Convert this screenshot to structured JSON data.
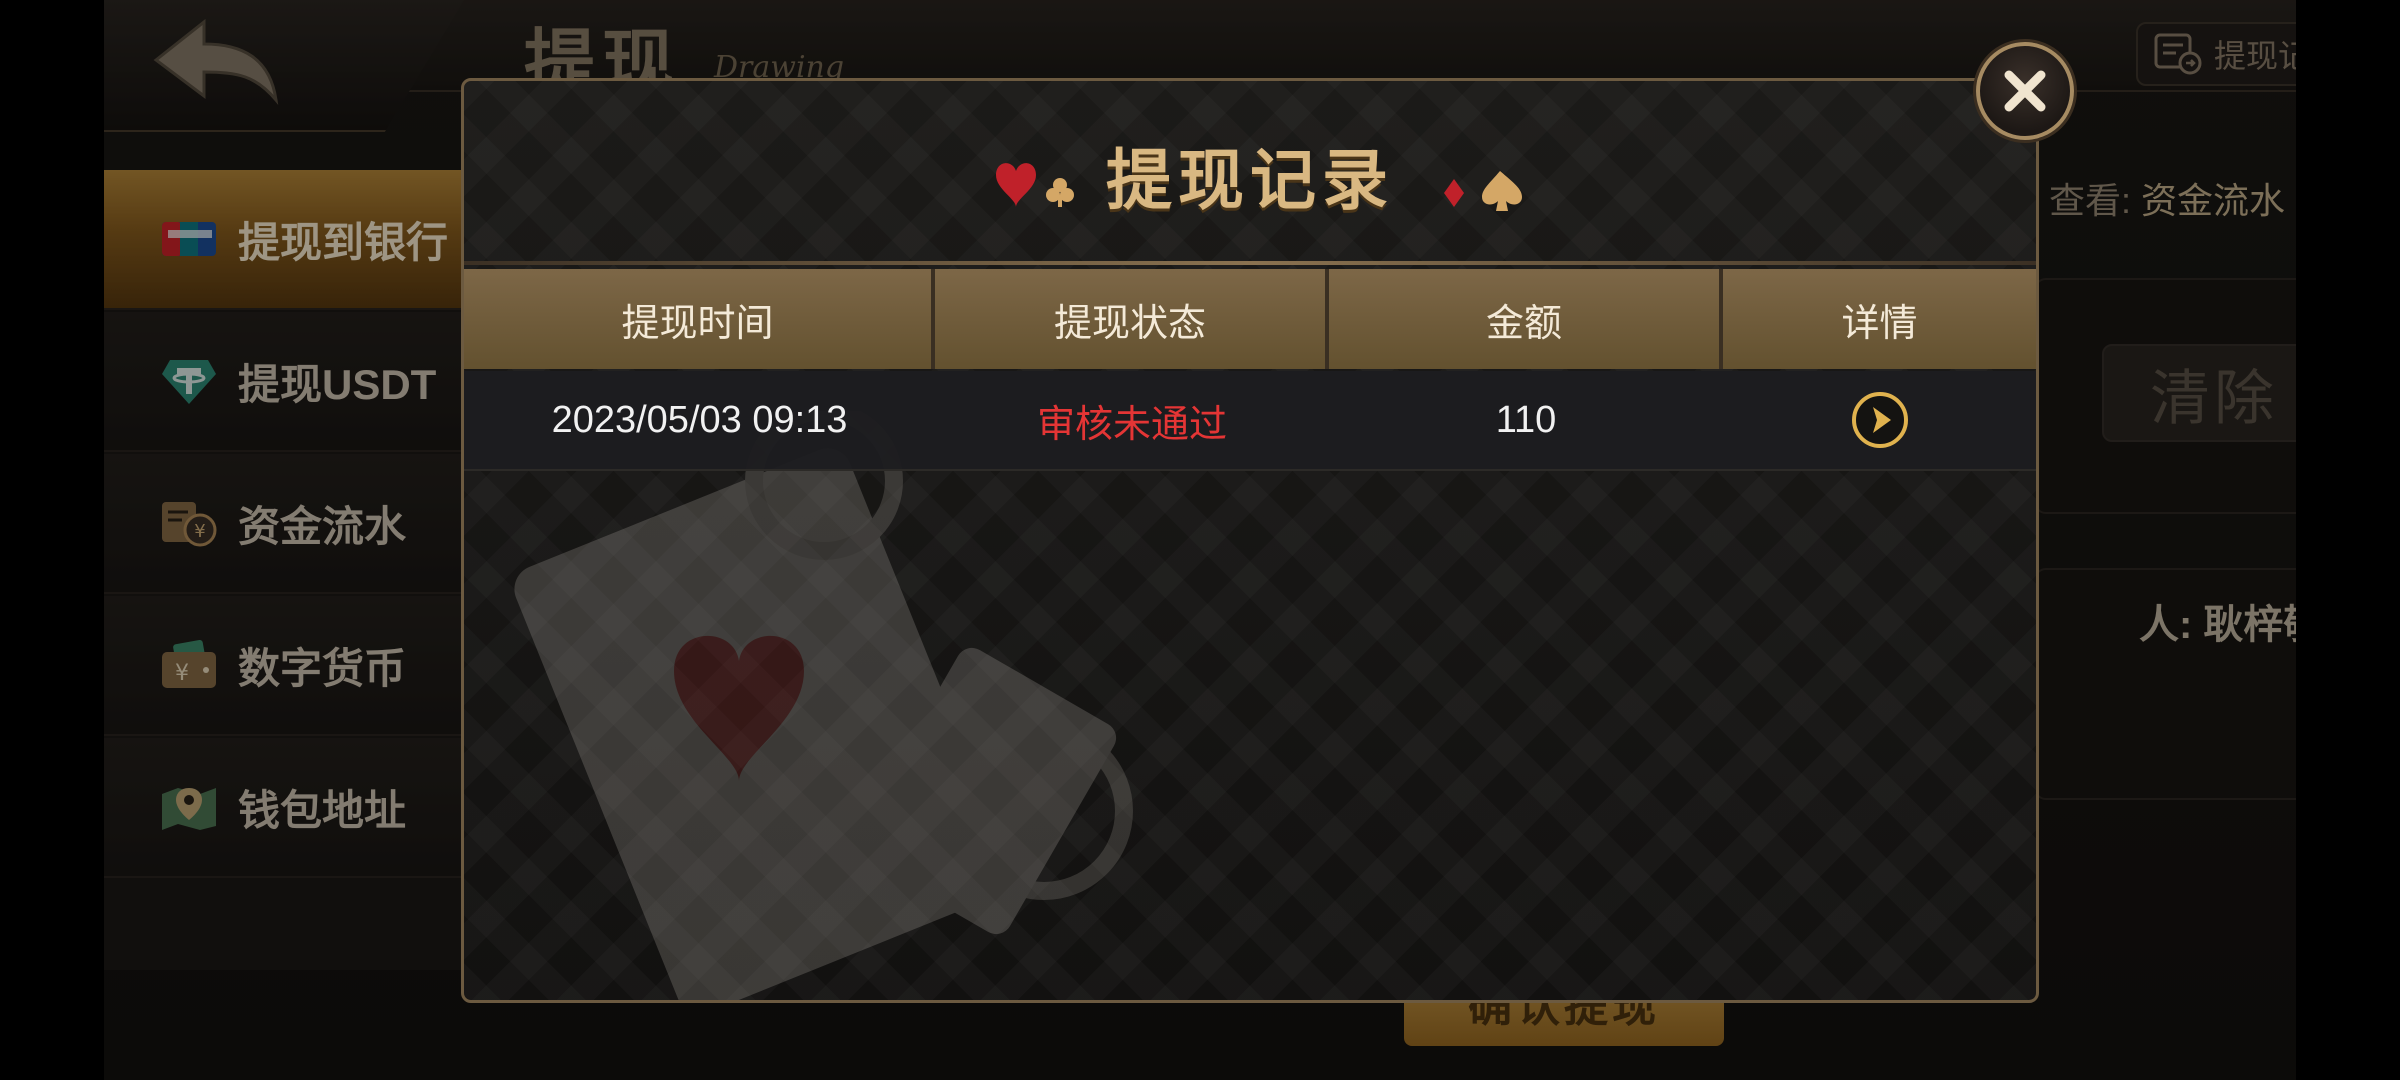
{
  "page": {
    "title": "提现",
    "subtitle": "Drawing",
    "record_button": "提现记录"
  },
  "sidebar": {
    "items": [
      {
        "label": "提现到银行",
        "icon": "unionpay-card-icon",
        "active": true
      },
      {
        "label": "提现USDT",
        "icon": "tether-icon",
        "active": false
      },
      {
        "label": "资金流水",
        "icon": "funds-flow-icon",
        "active": false
      },
      {
        "label": "数字货币",
        "icon": "wallet-icon",
        "active": false
      },
      {
        "label": "钱包地址",
        "icon": "map-pin-icon",
        "active": false
      }
    ]
  },
  "background": {
    "view_prefix": "查看:",
    "view_link": "资金流水",
    "clear_button": "清除",
    "person_label": "人: 耿梓敬",
    "withdraw_button": "确认提现"
  },
  "modal": {
    "title": "提现记录",
    "columns": [
      "提现时间",
      "提现状态",
      "金额",
      "详情"
    ],
    "rows": [
      {
        "time": "2023/05/03 09:13",
        "status": "审核未通过",
        "amount": "110"
      }
    ]
  },
  "colors": {
    "accent_gold": "#d9b882",
    "status_rejected": "#e43535",
    "header_brown": "#7d6747"
  }
}
